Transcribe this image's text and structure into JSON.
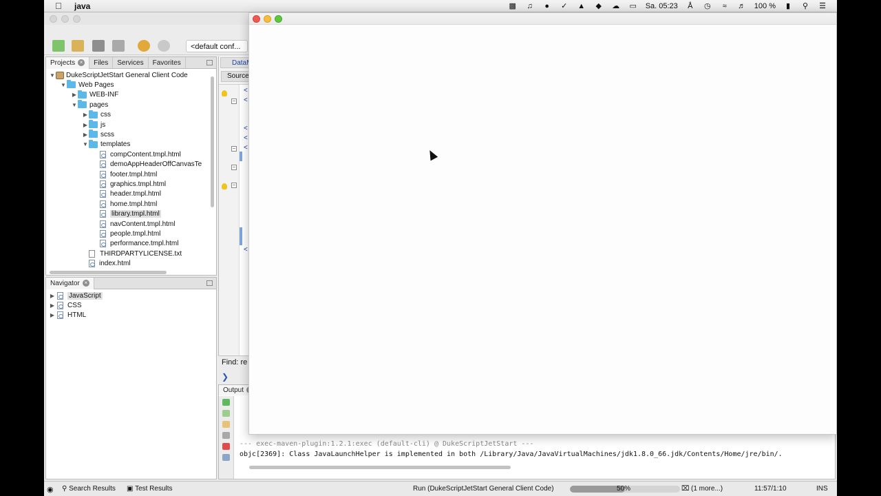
{
  "menubar": {
    "app_name": "java",
    "clock": "Sa. 05:23",
    "battery": "100 %",
    "icons": [
      "apple-icon",
      "facetime-icon",
      "notification-icon",
      "evernote-icon",
      "check-icon",
      "twitter-icon",
      "dropbox-icon",
      "cloud-icon",
      "airplay-icon",
      "bluetooth-icon",
      "timemachine-icon",
      "wifi-icon",
      "volume-icon",
      "battery-icon",
      "spotlight-icon",
      "menu-list-icon"
    ]
  },
  "toolbar": {
    "config": "<default conf..."
  },
  "projects_panel": {
    "tabs": [
      {
        "label": "Projects"
      },
      {
        "label": "Files"
      },
      {
        "label": "Services"
      },
      {
        "label": "Favorites"
      }
    ],
    "tree": [
      {
        "label": "DukeScriptJetStart General Client Code",
        "type": "project",
        "depth": 0,
        "expanded": true
      },
      {
        "label": "Web Pages",
        "type": "folder",
        "depth": 1,
        "expanded": true
      },
      {
        "label": "WEB-INF",
        "type": "folder",
        "depth": 2,
        "expanded": false
      },
      {
        "label": "pages",
        "type": "folder",
        "depth": 2,
        "expanded": true
      },
      {
        "label": "css",
        "type": "folder",
        "depth": 3,
        "expanded": false
      },
      {
        "label": "js",
        "type": "folder",
        "depth": 3,
        "expanded": false
      },
      {
        "label": "scss",
        "type": "folder",
        "depth": 3,
        "expanded": false
      },
      {
        "label": "templates",
        "type": "folder",
        "depth": 3,
        "expanded": true
      },
      {
        "label": "compContent.tmpl.html",
        "type": "file",
        "depth": 4
      },
      {
        "label": "demoAppHeaderOffCanvasTe",
        "type": "file",
        "depth": 4
      },
      {
        "label": "footer.tmpl.html",
        "type": "file",
        "depth": 4
      },
      {
        "label": "graphics.tmpl.html",
        "type": "file",
        "depth": 4
      },
      {
        "label": "header.tmpl.html",
        "type": "file",
        "depth": 4
      },
      {
        "label": "home.tmpl.html",
        "type": "file",
        "depth": 4
      },
      {
        "label": "library.tmpl.html",
        "type": "file",
        "depth": 4,
        "selected": true
      },
      {
        "label": "navContent.tmpl.html",
        "type": "file",
        "depth": 4
      },
      {
        "label": "people.tmpl.html",
        "type": "file",
        "depth": 4
      },
      {
        "label": "performance.tmpl.html",
        "type": "file",
        "depth": 4
      },
      {
        "label": "THIRDPARTYLICENSE.txt",
        "type": "txt",
        "depth": 3
      },
      {
        "label": "index.html",
        "type": "file",
        "depth": 3
      }
    ]
  },
  "navigator_panel": {
    "tab": "Navigator",
    "items": [
      {
        "label": "JavaScript",
        "selected": true
      },
      {
        "label": "CSS"
      },
      {
        "label": "HTML"
      }
    ]
  },
  "editor": {
    "tab_label": "DataM",
    "source_tab": "Source",
    "find_label": "Find: re"
  },
  "output_panel": {
    "tab": "Output",
    "lines": [
      "--- exec-maven-plugin:1.2.1:exec (default-cli) @ DukeScriptJetStart ---",
      "objc[2369]: Class JavaLaunchHelper is implemented in both /Library/Java/JavaVirtualMachines/jdk1.8.0_66.jdk/Contents/Home/jre/bin/."
    ]
  },
  "statusbar": {
    "search_results": "Search Results",
    "test_results": "Test Results",
    "run_task": "Run (DukeScriptJetStart General Client Code)",
    "progress_percent": 50,
    "progress_label": "50%",
    "more": "(1 more...)",
    "position": "11:57/1:10",
    "mode": "INS"
  },
  "colors": {
    "folder": "#5cb8e8",
    "accent_link": "#1a3ca8"
  }
}
